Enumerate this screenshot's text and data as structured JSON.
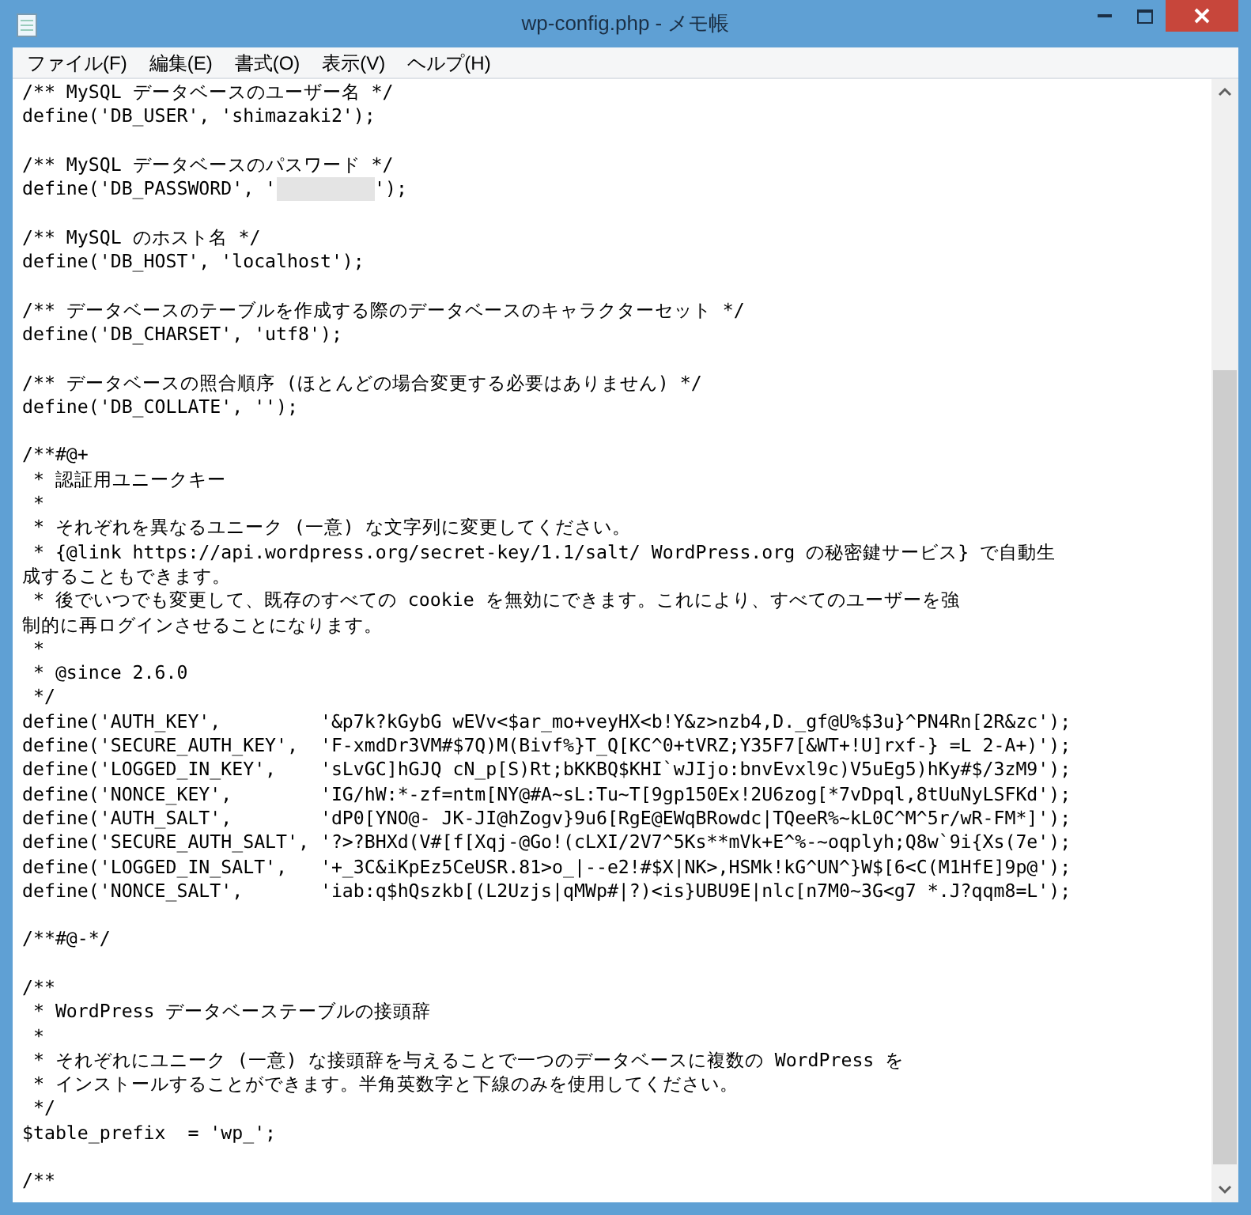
{
  "window": {
    "title": "wp-config.php - メモ帳"
  },
  "menu": [
    "ファイル(F)",
    "編集(E)",
    "書式(O)",
    "表示(V)",
    "ヘルプ(H)"
  ],
  "lines": [
    {
      "kind": "code",
      "text": "/** MySQL データベースのユーザー名 */"
    },
    {
      "kind": "code",
      "text": "define('DB_USER', 'shimazaki2');"
    },
    {
      "kind": "blank"
    },
    {
      "kind": "code",
      "text": "/** MySQL データベースのパスワード */"
    },
    {
      "kind": "redacted",
      "before": "define('DB_PASSWORD', '",
      "after": "');"
    },
    {
      "kind": "blank"
    },
    {
      "kind": "code",
      "text": "/** MySQL のホスト名 */"
    },
    {
      "kind": "code",
      "text": "define('DB_HOST', 'localhost');"
    },
    {
      "kind": "blank"
    },
    {
      "kind": "code",
      "text": "/** データベースのテーブルを作成する際のデータベースのキャラクターセット */"
    },
    {
      "kind": "code",
      "text": "define('DB_CHARSET', 'utf8');"
    },
    {
      "kind": "blank"
    },
    {
      "kind": "code",
      "text": "/** データベースの照合順序 (ほとんどの場合変更する必要はありません) */"
    },
    {
      "kind": "code",
      "text": "define('DB_COLLATE', '');"
    },
    {
      "kind": "blank"
    },
    {
      "kind": "code",
      "text": "/**#@+"
    },
    {
      "kind": "code",
      "text": " * 認証用ユニークキー"
    },
    {
      "kind": "code",
      "text": " *"
    },
    {
      "kind": "code",
      "text": " * それぞれを異なるユニーク (一意) な文字列に変更してください。"
    },
    {
      "kind": "code",
      "text": " * {@link https://api.wordpress.org/secret-key/1.1/salt/ WordPress.org の秘密鍵サービス} で自動生"
    },
    {
      "kind": "code",
      "text": "成することもできます。"
    },
    {
      "kind": "code",
      "text": " * 後でいつでも変更して、既存のすべての cookie を無効にできます。これにより、すべてのユーザーを強"
    },
    {
      "kind": "code",
      "text": "制的に再ログインさせることになります。"
    },
    {
      "kind": "code",
      "text": " *"
    },
    {
      "kind": "code",
      "text": " * @since 2.6.0"
    },
    {
      "kind": "code",
      "text": " */"
    },
    {
      "kind": "code",
      "text": "define('AUTH_KEY',         '&p7k?kGybG wEVv<$ar_mo+veyHX<b!Y&z>nzb4,D._gf@U%$3u}^PN4Rn[2R&zc');"
    },
    {
      "kind": "code",
      "text": "define('SECURE_AUTH_KEY',  'F-xmdDr3VM#$7Q)M(Bivf%}T_Q[KC^0+tVRZ;Y35F7[&WT+!U]rxf-} =L 2-A+)');"
    },
    {
      "kind": "code",
      "text": "define('LOGGED_IN_KEY',    'sLvGC]hGJQ cN_p[S)Rt;bKKBQ$KHI`wJIjo:bnvEvxl9c)V5uEg5)hKy#$/3zM9');"
    },
    {
      "kind": "code",
      "text": "define('NONCE_KEY',        'IG/hW:*-zf=ntm[NY@#A~sL:Tu~T[9gp150Ex!2U6zog[*7vDpql,8tUuNyLSFKd');"
    },
    {
      "kind": "code",
      "text": "define('AUTH_SALT',        'dP0[YNO@- JK-JI@hZogv}9u6[RgE@EWqBRowdc|TQeeR%~kL0C^M^5r/wR-FM*]');"
    },
    {
      "kind": "code",
      "text": "define('SECURE_AUTH_SALT', '?>?BHXd(V#[f[Xqj-@Go!(cLXI/2V7^5Ks**mVk+E^%-~oqplyh;Q8w`9i{Xs(7e');"
    },
    {
      "kind": "code",
      "text": "define('LOGGED_IN_SALT',   '+_3C&iKpEz5CeUSR.81>o_|--e2!#$X|NK>,HSMk!kG^UN^}W$[6<C(M1HfE]9p@');"
    },
    {
      "kind": "code",
      "text": "define('NONCE_SALT',       'iab:q$hQszkb[(L2Uzjs|qMWp#|?)<is}UBU9E|nlc[n7M0~3G<g7 *.J?qqm8=L');"
    },
    {
      "kind": "blank"
    },
    {
      "kind": "code",
      "text": "/**#@-*/"
    },
    {
      "kind": "blank"
    },
    {
      "kind": "code",
      "text": "/**"
    },
    {
      "kind": "code",
      "text": " * WordPress データベーステーブルの接頭辞"
    },
    {
      "kind": "code",
      "text": " *"
    },
    {
      "kind": "code",
      "text": " * それぞれにユニーク (一意) な接頭辞を与えることで一つのデータベースに複数の WordPress を"
    },
    {
      "kind": "code",
      "text": " * インストールすることができます。半角英数字と下線のみを使用してください。"
    },
    {
      "kind": "code",
      "text": " */"
    },
    {
      "kind": "code",
      "text": "$table_prefix  = 'wp_';"
    },
    {
      "kind": "blank"
    },
    {
      "kind": "code",
      "text": "/**"
    }
  ]
}
